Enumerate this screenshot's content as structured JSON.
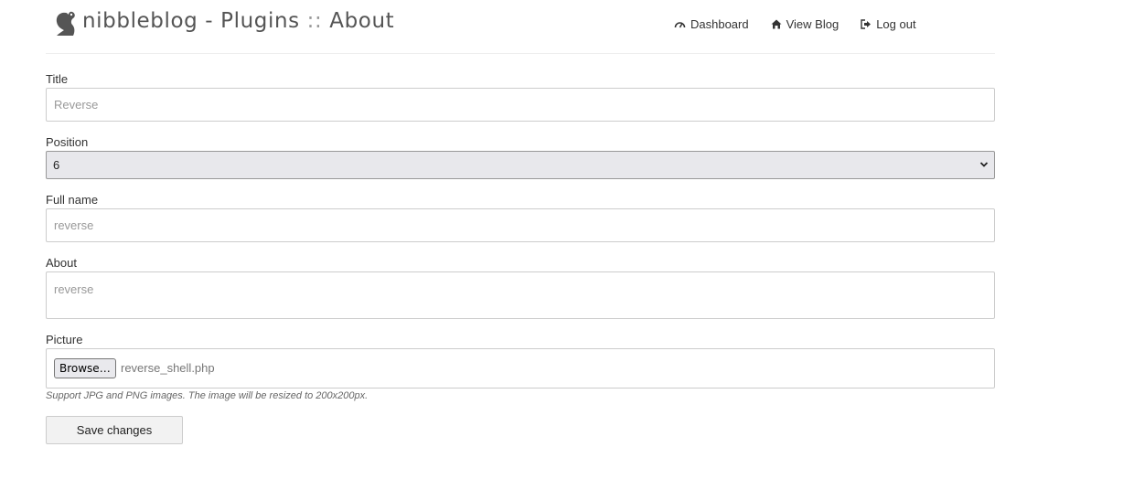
{
  "header": {
    "brand": "nibbleblog",
    "separator": "-",
    "section": "Plugins",
    "path_sep": "::",
    "page": "About"
  },
  "nav": [
    {
      "label": "Dashboard",
      "icon": "dashboard-icon"
    },
    {
      "label": "View Blog",
      "icon": "home-icon"
    },
    {
      "label": "Log out",
      "icon": "logout-icon"
    }
  ],
  "form": {
    "title_label": "Title",
    "title_value": "Reverse",
    "position_label": "Position",
    "position_value": "6",
    "fullname_label": "Full name",
    "fullname_value": "reverse",
    "about_label": "About",
    "about_value": "reverse",
    "picture_label": "Picture",
    "browse_label": "Browse…",
    "file_name": "reverse_shell.php",
    "picture_hint": "Support JPG and PNG images. The image will be resized to 200x200px.",
    "save_label": "Save changes"
  }
}
